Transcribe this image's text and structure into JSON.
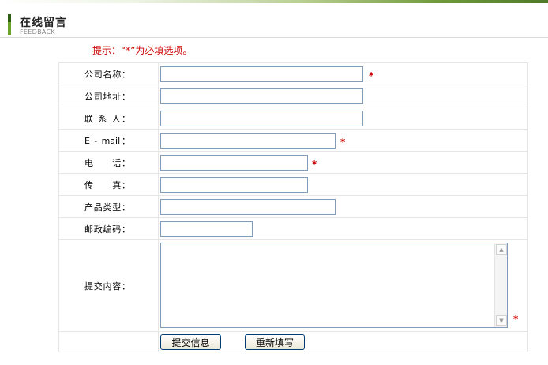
{
  "header": {
    "title_cn": "在线留言",
    "title_en": "FEEDBACK"
  },
  "hint": "提示：“*”为必填选项。",
  "fields": [
    {
      "label": "公司名称：",
      "required": true
    },
    {
      "label": "公司地址：",
      "required": false
    },
    {
      "label": "联 系 人：",
      "required": false
    },
    {
      "label": "E - mail：",
      "required": true
    },
    {
      "label": "电　　话：",
      "required": true
    },
    {
      "label": "传　　真：",
      "required": false
    },
    {
      "label": "产品类型：",
      "required": false
    },
    {
      "label": "邮政编码：",
      "required": false
    }
  ],
  "content_label": "提交内容：",
  "required_mark": "*",
  "buttons": {
    "submit": "提交信息",
    "reset": "重新填写"
  },
  "colors": {
    "accent_green": "#6aa325",
    "required_red": "#cc0000",
    "input_border": "#7f9db9"
  }
}
